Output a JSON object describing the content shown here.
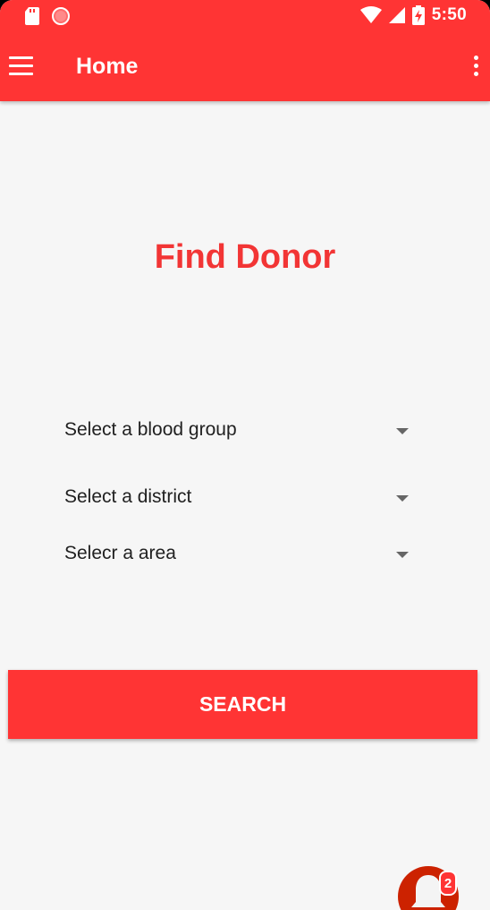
{
  "status_bar": {
    "time": "5:50",
    "icons": [
      "sd-card-icon",
      "record-icon",
      "wifi-icon",
      "signal-icon",
      "battery-charging-icon"
    ]
  },
  "toolbar": {
    "title": "Home",
    "menu_icon": "hamburger-menu-icon",
    "overflow_icon": "more-vert-icon"
  },
  "main": {
    "heading": "Find Donor",
    "spinners": [
      {
        "label": "Select a blood group"
      },
      {
        "label": "Select a district"
      },
      {
        "label": "Selecr a area"
      }
    ],
    "search_label": "SEARCH"
  },
  "fab": {
    "icon": "bell-icon",
    "badge_count": "2"
  },
  "colors": {
    "primary": "#ff3434",
    "heading": "#f23535",
    "fab": "#cc2200",
    "background": "#f6f6f6"
  }
}
